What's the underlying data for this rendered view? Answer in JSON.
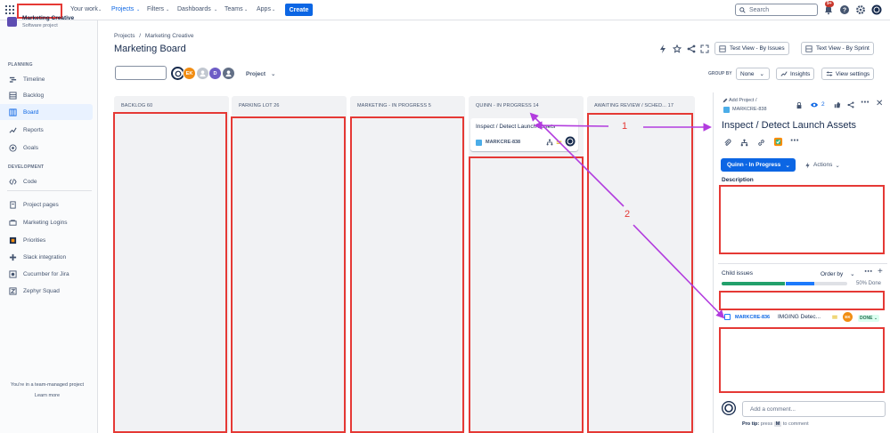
{
  "topnav": {
    "items": [
      {
        "label": "Your work",
        "active": false
      },
      {
        "label": "Projects",
        "active": true
      },
      {
        "label": "Filters",
        "active": false
      },
      {
        "label": "Dashboards",
        "active": false
      },
      {
        "label": "Teams",
        "active": false
      },
      {
        "label": "Apps",
        "active": false
      }
    ],
    "create_label": "Create",
    "search_placeholder": "Search",
    "notification_count": "9+"
  },
  "sidebar": {
    "project_name": "Marketing Creative",
    "project_type": "Software project",
    "planning_label": "PLANNING",
    "planning_items": [
      {
        "label": "Timeline",
        "icon": "timeline-icon"
      },
      {
        "label": "Backlog",
        "icon": "backlog-icon"
      },
      {
        "label": "Board",
        "icon": "board-icon",
        "active": true
      },
      {
        "label": "Reports",
        "icon": "reports-icon"
      },
      {
        "label": "Goals",
        "icon": "goals-icon"
      }
    ],
    "development_label": "DEVELOPMENT",
    "development_items": [
      {
        "label": "Code",
        "icon": "code-icon"
      }
    ],
    "other_items": [
      {
        "label": "Project pages",
        "icon": "pages-icon"
      },
      {
        "label": "Marketing Logins",
        "icon": "link-icon"
      },
      {
        "label": "Priorities",
        "icon": "priorities-icon"
      },
      {
        "label": "Slack integration",
        "icon": "slack-icon"
      },
      {
        "label": "Cucumber for Jira",
        "icon": "cucumber-icon"
      },
      {
        "label": "Zephyr Squad",
        "icon": "zephyr-icon"
      }
    ],
    "footer_text": "You're in a team-managed project",
    "learn_more": "Learn more"
  },
  "board": {
    "breadcrumb": [
      "Projects",
      "Marketing Creative"
    ],
    "title": "Marketing Board",
    "view_buttons": [
      "Test View - By Issues",
      "Text View - By Sprint"
    ],
    "avatars": [
      {
        "initials": "",
        "color": "#172b4d"
      },
      {
        "initials": "EK",
        "color": "#f18d13"
      },
      {
        "initials": "",
        "color": "#8590a2"
      },
      {
        "initials": "D",
        "color": "#6e5dc6"
      },
      {
        "initials": "",
        "color": "#626f86"
      }
    ],
    "project_filter": "Project",
    "group_by_label": "GROUP BY",
    "group_by_value": "None",
    "insights_label": "Insights",
    "view_settings_label": "View settings",
    "columns": [
      {
        "title": "BACKLOG 60"
      },
      {
        "title": "PARKING LOT 26"
      },
      {
        "title": "MARKETING - IN PROGRESS 5"
      },
      {
        "title": "QUINN - IN PROGRESS 14"
      },
      {
        "title": "AWAITING REVIEW / SCHED...  17"
      }
    ],
    "card": {
      "title": "Inspect / Detect Launch Assets",
      "key": "MARKCRE-838"
    }
  },
  "panel": {
    "crumb": "Add Project  /",
    "key": "MARKCRE-838",
    "watchers": "2",
    "title": "Inspect / Detect Launch Assets",
    "status": "Quinn - In Progress",
    "actions_label": "Actions",
    "description_label": "Description",
    "child_issues_label": "Child issues",
    "order_by_label": "Order by",
    "progress_done_fraction": 0.5,
    "progress_done_label": "50% Done",
    "child": {
      "key": "MARKCRE-836",
      "summary": "IMGING Detec...",
      "assignee": "EK",
      "status": "DONE"
    },
    "comment_placeholder": "Add a comment...",
    "protip_prefix": "Pro tip:",
    "protip_mid": " press ",
    "protip_key": "M",
    "protip_suffix": " to comment"
  },
  "annotations": {
    "label_1": "1",
    "label_2": "2"
  }
}
